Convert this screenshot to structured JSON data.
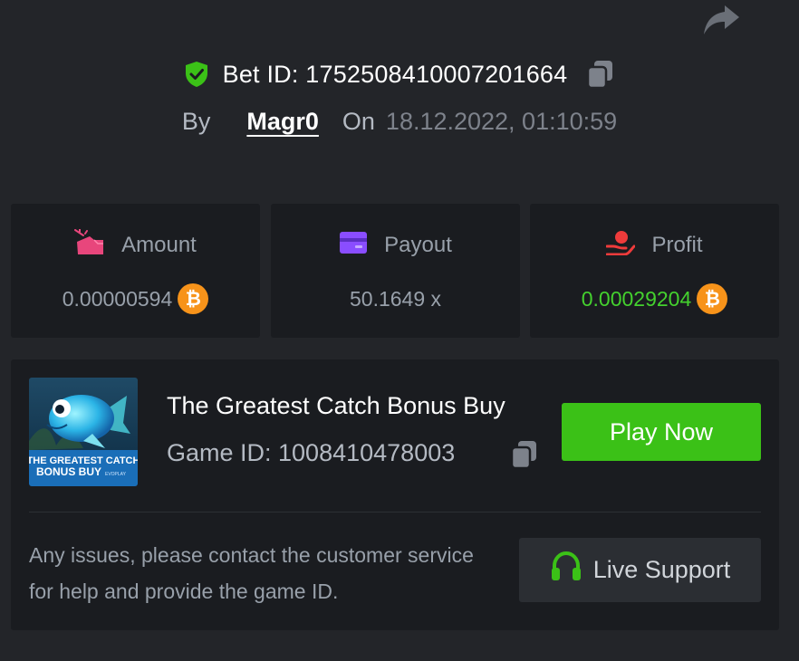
{
  "header": {
    "bet_id_label": "Bet ID: 1752508410007201664",
    "by_label": "By",
    "username": "Magr0",
    "on_label": "On",
    "datetime": "18.12.2022, 01:10:59"
  },
  "stats": [
    {
      "label": "Amount",
      "value": "0.00000594",
      "icon": "bet-amount-icon",
      "currency": "bitcoin-icon"
    },
    {
      "label": "Payout",
      "value": "50.1649 x",
      "icon": "card-icon"
    },
    {
      "label": "Profit",
      "value": "0.00029204",
      "icon": "hand-coin-icon",
      "currency": "bitcoin-icon",
      "value_color": "#44d12e"
    }
  ],
  "game": {
    "name": "The Greatest Catch Bonus Buy",
    "game_id_label": "Game ID: 1008410478003",
    "thumbnail_text_line1": "THE GREATEST CATCH",
    "thumbnail_text_line2": "BONUS BUY",
    "thumbnail_brand": "EVOPLAY",
    "play_button": "Play Now",
    "help_text": "Any issues, please contact the customer service for help and provide the game ID.",
    "support_button": "Live Support"
  },
  "colors": {
    "background": "#232529",
    "card": "#1a1c20",
    "accent_green": "#3bc117",
    "profit_green": "#44d12e",
    "bitcoin_orange": "#f7931a"
  }
}
